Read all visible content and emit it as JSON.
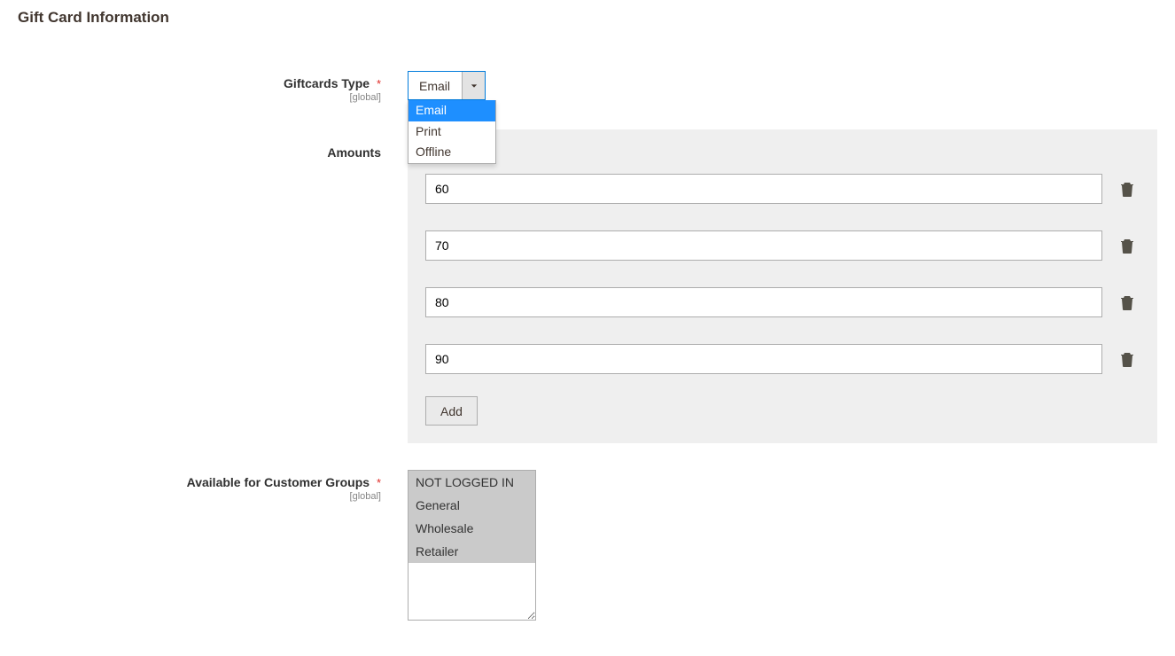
{
  "section_title": "Gift Card Information",
  "fields": {
    "giftcards_type": {
      "label": "Giftcards Type",
      "scope": "[global]",
      "required": true,
      "selected": "Email",
      "options": [
        "Email",
        "Print",
        "Offline"
      ]
    },
    "amounts": {
      "label": "Amounts",
      "values": [
        "60",
        "70",
        "80",
        "90"
      ],
      "add_label": "Add"
    },
    "customer_groups": {
      "label": "Available for Customer Groups",
      "scope": "[global]",
      "required": true,
      "options": [
        "NOT LOGGED IN",
        "General",
        "Wholesale",
        "Retailer"
      ],
      "selected": [
        0,
        1,
        2,
        3
      ]
    }
  },
  "required_mark": "*"
}
